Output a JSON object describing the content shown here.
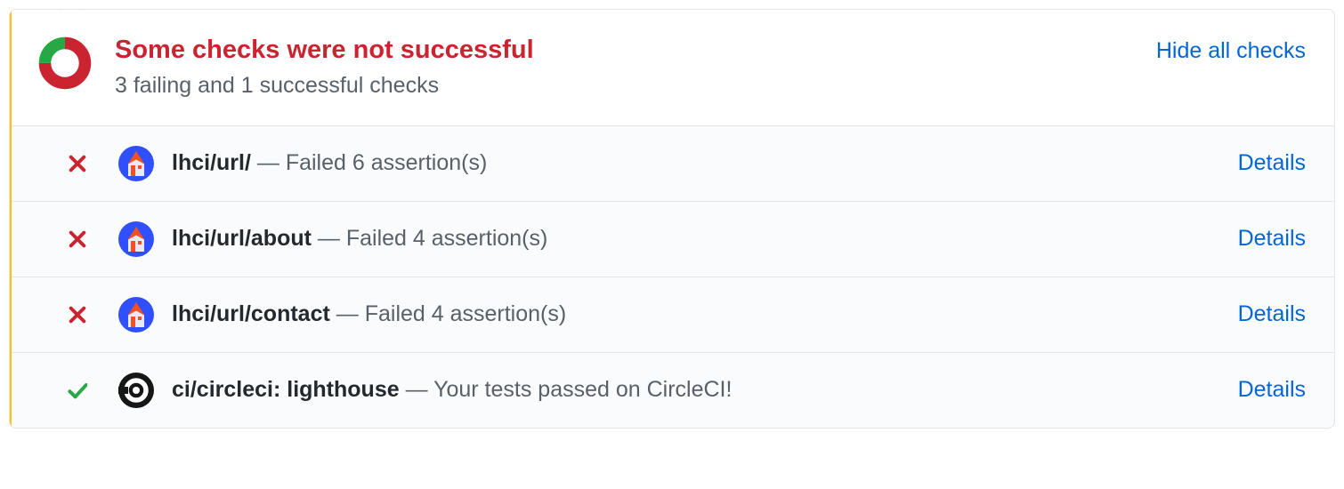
{
  "header": {
    "title": "Some checks were not successful",
    "subtitle": "3 failing and 1 successful checks",
    "toggle_label": "Hide all checks",
    "donut": {
      "success_frac": 0.25,
      "fail_frac": 0.75
    }
  },
  "common": {
    "separator": " — ",
    "details_label": "Details"
  },
  "checks": [
    {
      "status": "fail",
      "icon": "lhci",
      "name": "lhci/url/",
      "message": "Failed 6 assertion(s)"
    },
    {
      "status": "fail",
      "icon": "lhci",
      "name": "lhci/url/about",
      "message": "Failed 4 assertion(s)"
    },
    {
      "status": "fail",
      "icon": "lhci",
      "name": "lhci/url/contact",
      "message": "Failed 4 assertion(s)"
    },
    {
      "status": "success",
      "icon": "circleci",
      "name": "ci/circleci: lighthouse",
      "message": "Your tests passed on CircleCI!"
    }
  ]
}
